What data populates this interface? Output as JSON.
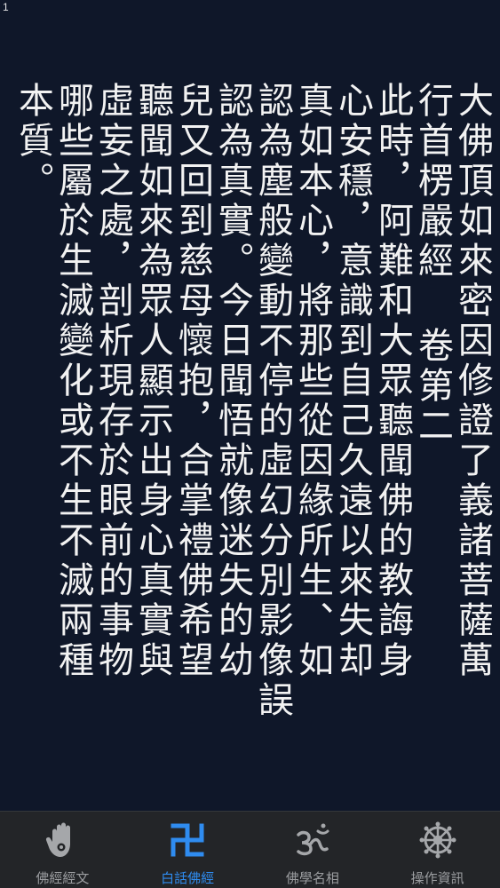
{
  "status": {
    "page_number": "1"
  },
  "reader": {
    "columns": [
      "大佛頂如來密因修證了義諸菩薩萬",
      "行首楞嚴經 卷第二",
      "此時，阿難和大眾聽聞佛的教誨身",
      "心安穩，意識到自己久遠以來失却",
      "真如本心，將那些從因緣所生、如",
      "認為塵般變動不停的虛幻分別影像誤",
      "認為真實。今日聞悟就像迷失的幼",
      "兒又回到慈母懷抱，合掌禮佛希望",
      "聽聞如來為眾人顯示出身心真實與",
      "虛妄之處，剖析現存於眼前的事物",
      "哪些屬於生滅變化或不生不滅兩種",
      "本質。"
    ]
  },
  "tabbar": {
    "tabs": [
      {
        "label": "佛經經文",
        "icon": "hand-icon",
        "active": false
      },
      {
        "label": "白話佛經",
        "icon": "swastika-icon",
        "active": true
      },
      {
        "label": "佛學名相",
        "icon": "om-icon",
        "active": false
      },
      {
        "label": "操作資訊",
        "icon": "dharma-wheel-icon",
        "active": false
      }
    ]
  },
  "colors": {
    "background": "#0f1729",
    "text": "#f2f2f2",
    "tabbar_bg": "#232528",
    "tab_inactive": "#9b9da0",
    "tab_active": "#2f8cf0"
  }
}
